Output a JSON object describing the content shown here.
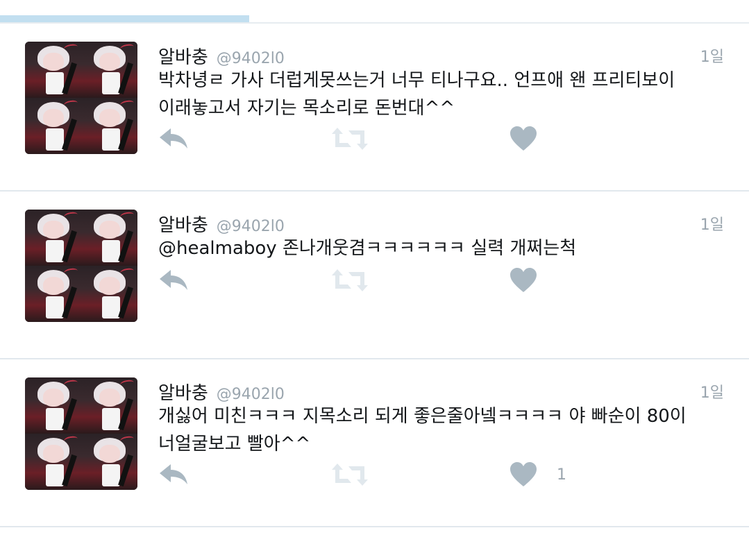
{
  "timeline": {
    "progress_fraction": 0.333,
    "tweets": [
      {
        "display_name": "알바충",
        "handle": "@9402l0",
        "time": "1일",
        "text": "박차녕ㄹ 가사 더럽게못쓰는거 너무 티나구요.. 언프애 왠 프리티보이\n이래놓고서 자기는 목소리로 돈번대^^",
        "like_count": ""
      },
      {
        "display_name": "알바충",
        "handle": "@9402l0",
        "time": "1일",
        "text": "@healmaboy 존나개웃겸ㅋㅋㅋㅋㅋㅋ 실력 개쩌는척",
        "like_count": ""
      },
      {
        "display_name": "알바충",
        "handle": "@9402l0",
        "time": "1일",
        "text": "개싫어 미친ㅋㅋㅋ 지목소리 되게 좋은줄아넼ㅋㅋㅋㅋ 야 빠순이 80이\n너얼굴보고 빨아^^",
        "like_count": "1"
      }
    ]
  },
  "icons": {
    "reply": "reply-icon",
    "retweet": "retweet-icon",
    "like": "heart-icon"
  },
  "colors": {
    "icon": "#aab8c2",
    "secondary_text": "#9aa5ae",
    "progress": "#c2dff0",
    "divider": "#e1e8ed"
  }
}
